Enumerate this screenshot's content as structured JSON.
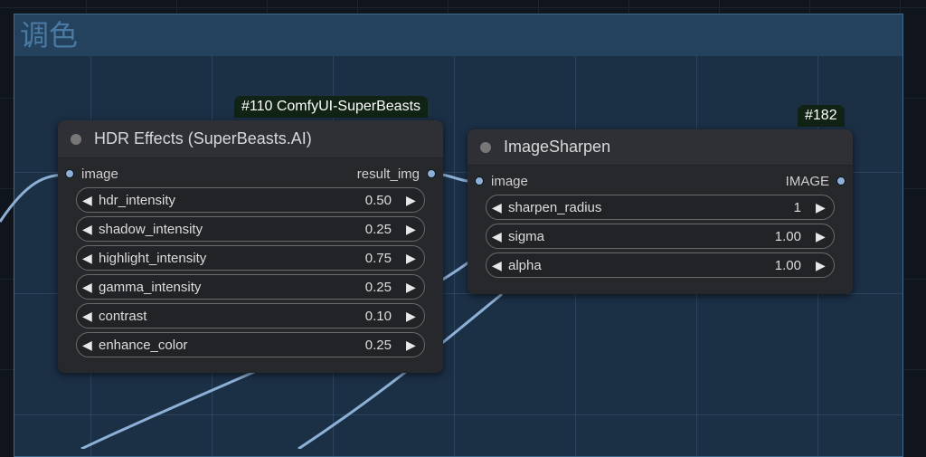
{
  "group": {
    "title": "调色"
  },
  "nodes": [
    {
      "badge": "#110 ComfyUI-SuperBeasts",
      "title": "HDR Effects (SuperBeasts.AI)",
      "input": "image",
      "output": "result_img",
      "widgets": [
        {
          "label": "hdr_intensity",
          "value": "0.50"
        },
        {
          "label": "shadow_intensity",
          "value": "0.25"
        },
        {
          "label": "highlight_intensity",
          "value": "0.75"
        },
        {
          "label": "gamma_intensity",
          "value": "0.25"
        },
        {
          "label": "contrast",
          "value": "0.10"
        },
        {
          "label": "enhance_color",
          "value": "0.25"
        }
      ]
    },
    {
      "badge": "#182",
      "title": "ImageSharpen",
      "input": "image",
      "output": "IMAGE",
      "widgets": [
        {
          "label": "sharpen_radius",
          "value": "1"
        },
        {
          "label": "sigma",
          "value": "1.00"
        },
        {
          "label": "alpha",
          "value": "1.00"
        }
      ]
    }
  ],
  "icons": {
    "left": "◀",
    "right": "▶"
  }
}
